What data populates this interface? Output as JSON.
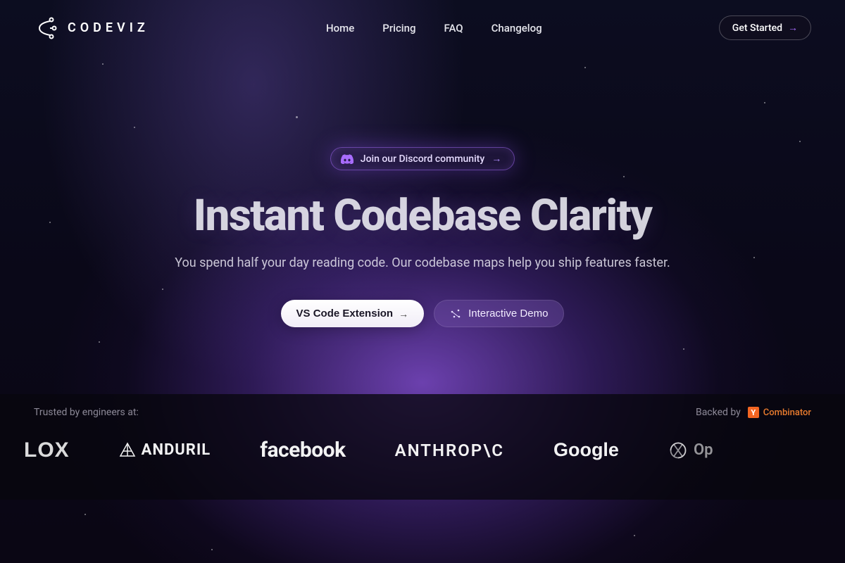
{
  "brand": {
    "name": "CODEVIZ"
  },
  "nav": {
    "items": [
      {
        "label": "Home",
        "key": "home"
      },
      {
        "label": "Pricing",
        "key": "pricing"
      },
      {
        "label": "FAQ",
        "key": "faq"
      },
      {
        "label": "Changelog",
        "key": "changelog"
      }
    ]
  },
  "header_cta": {
    "label": "Get Started"
  },
  "hero": {
    "discord_label": "Join our Discord community",
    "headline": "Instant Codebase Clarity",
    "subhead": "You spend half your day reading code. Our codebase maps help you ship features faster.",
    "primary_btn": "VS Code Extension",
    "secondary_btn": "Interactive Demo"
  },
  "strip": {
    "trusted_label": "Trusted by engineers at:",
    "backed_label": "Backed by",
    "backed_name": "Combinator",
    "yc_letter": "Y",
    "companies": [
      {
        "key": "roblox",
        "display": "LOX"
      },
      {
        "key": "anduril",
        "display": "ANDURIL"
      },
      {
        "key": "facebook",
        "display": "facebook"
      },
      {
        "key": "anthropic",
        "display": "ANTHROP\\C"
      },
      {
        "key": "google",
        "display": "Google"
      },
      {
        "key": "openai",
        "display": "Op"
      }
    ]
  },
  "colors": {
    "accent_purple": "#a86cff",
    "yc_orange": "#f26522"
  }
}
